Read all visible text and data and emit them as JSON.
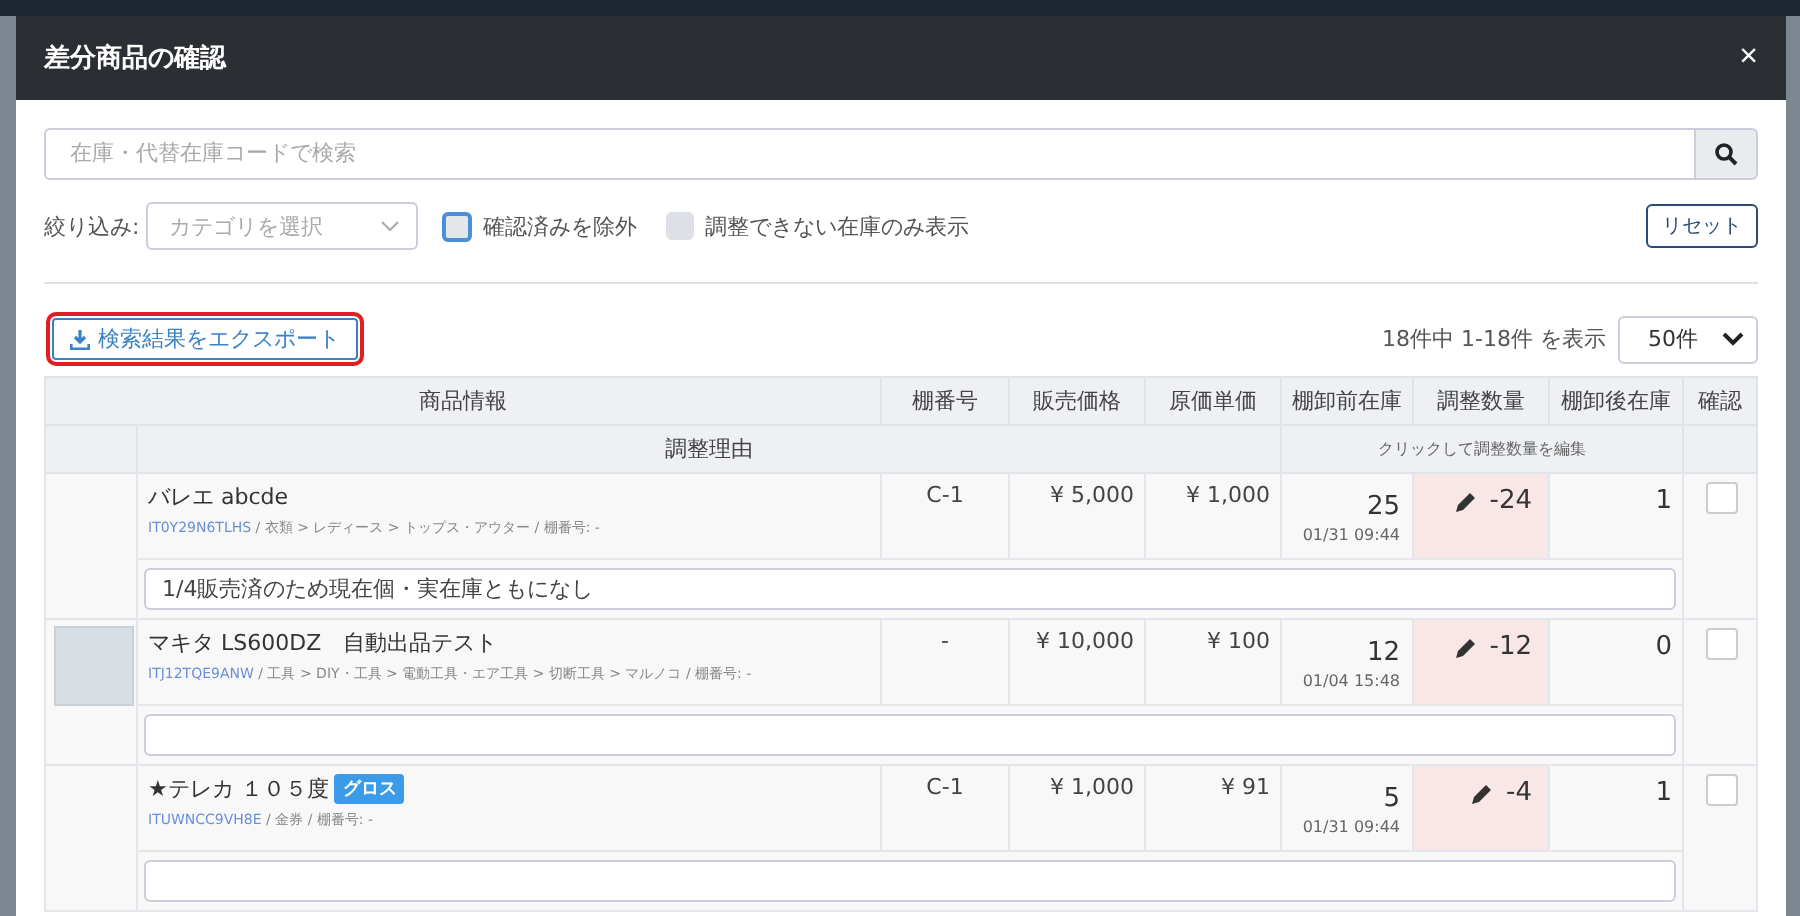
{
  "window": {
    "title": "差分商品の確認",
    "close": "×"
  },
  "search": {
    "placeholder": "在庫・代替在庫コードで検索"
  },
  "filter": {
    "label": "絞り込み:",
    "category_placeholder": "カテゴリを選択"
  },
  "checkboxes": [
    {
      "label": "確認済みを除外",
      "checked": false,
      "focused": true
    },
    {
      "label": "調整できない在庫のみ表示",
      "checked": false,
      "focused": false
    }
  ],
  "reset_button": "リセット",
  "export_button": {
    "label": "検索結果をエクスポート",
    "highlighted": true
  },
  "result_count": "18件中 1-18件 を表示",
  "page_size": "50件",
  "table": {
    "columns": [
      "商品情報",
      "棚番号",
      "販売価格",
      "原価単価",
      "棚卸前在庫",
      "調整数量",
      "棚卸後在庫",
      "確認"
    ],
    "subheader_reason": "調整理由",
    "subheader_hint": "クリックして調整数量を編集",
    "rows": [
      {
        "has_photo": false,
        "name": "バレエ abcde",
        "badge": "",
        "code": "IT0Y29N6TLHS",
        "path": "/ 衣類 > レディース > トップス・アウター / 棚番号: -",
        "shelf": "C-1",
        "price": "¥ 5,000",
        "cost": "¥ 1,000",
        "before": "25",
        "date": "01/31 09:44",
        "adjust": "-24",
        "after": "1",
        "checked": false,
        "reason": "1/4販売済のため現在個・実在庫ともになし"
      },
      {
        "has_photo": true,
        "name": "マキタ LS600DZ　自動出品テスト",
        "badge": "",
        "code": "ITJ12TQE9ANW",
        "path": "/ 工具 > DIY・工具 > 電動工具・エア工具 > 切断工具 > マルノコ / 棚番号: -",
        "shelf": "-",
        "price": "¥ 10,000",
        "cost": "¥ 100",
        "before": "12",
        "date": "01/04 15:48",
        "adjust": "-12",
        "after": "0",
        "checked": false,
        "reason": ""
      },
      {
        "has_photo": false,
        "name": "★テレカ １０５度",
        "badge": "グロス",
        "code": "ITUWNCC9VH8E",
        "path": "/ 金券 / 棚番号: -",
        "shelf": "C-1",
        "price": "¥ 1,000",
        "cost": "¥ 91",
        "before": "5",
        "date": "01/31 09:44",
        "adjust": "-4",
        "after": "1",
        "checked": false,
        "reason": ""
      }
    ]
  }
}
